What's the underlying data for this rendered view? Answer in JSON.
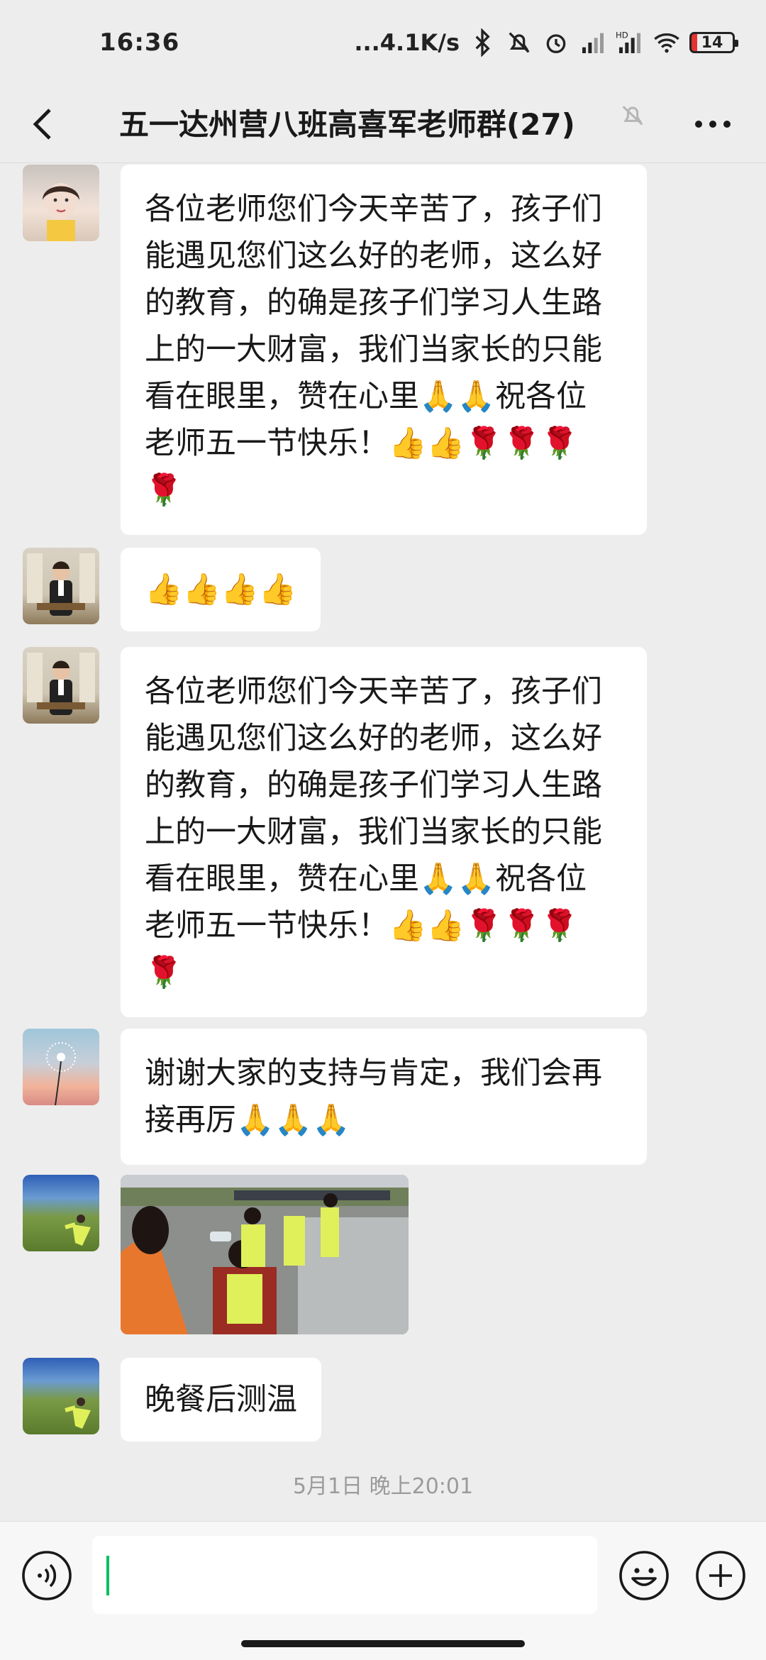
{
  "status_bar": {
    "time": "16:36",
    "network_speed": "...4.1K/s",
    "battery_level": "14",
    "icons": [
      "bluetooth-icon",
      "mute-icon",
      "alarm-icon",
      "signal-icon",
      "hd-signal-icon",
      "wifi-icon",
      "battery-icon"
    ]
  },
  "header": {
    "title": "五一达州营八班高喜军老师群(27)",
    "back_icon": "chevron-left-icon",
    "muted_icon": "bell-off-icon",
    "more_icon": "ellipsis-icon"
  },
  "messages": [
    {
      "avatar": "girl-selfie",
      "lines": [
        "各位老师您们今天辛苦了，孩子们",
        "能遇见您们这么好的老师，这么好",
        "的教育，的确是孩子们学习人生路",
        "上的一大财富，我们当家长的只能",
        "看在眼里，赞在心里🙏🙏祝各位",
        "老师五一节快乐！👍👍🌹🌹🌹",
        "🌹"
      ]
    },
    {
      "avatar": "teacher-portrait",
      "lines": [
        "👍👍👍👍"
      ]
    },
    {
      "avatar": "teacher-portrait",
      "lines": [
        "各位老师您们今天辛苦了，孩子们",
        "能遇见您们这么好的老师，这么好",
        "的教育，的确是孩子们学习人生路",
        "上的一大财富，我们当家长的只能",
        "看在眼里，赞在心里🙏🙏祝各位",
        "老师五一节快乐！👍👍🌹🌹🌹",
        "🌹"
      ]
    },
    {
      "avatar": "dandelion",
      "lines": [
        "谢谢大家的支持与肯定，我们会再",
        "接再厉🙏🙏🙏"
      ]
    },
    {
      "avatar": "field",
      "image": "photo-temperature-check"
    },
    {
      "avatar": "field",
      "lines": [
        "晚餐后测温"
      ]
    }
  ],
  "timestamp": "5月1日 晚上20:01",
  "input_bar": {
    "value": "",
    "voice_icon": "voice-icon",
    "emoji_icon": "emoji-icon",
    "plus_icon": "plus-icon"
  },
  "colors": {
    "background": "#ededed",
    "bubble": "#ffffff",
    "caret": "#07c160",
    "timestamp": "#9b9b9b"
  }
}
